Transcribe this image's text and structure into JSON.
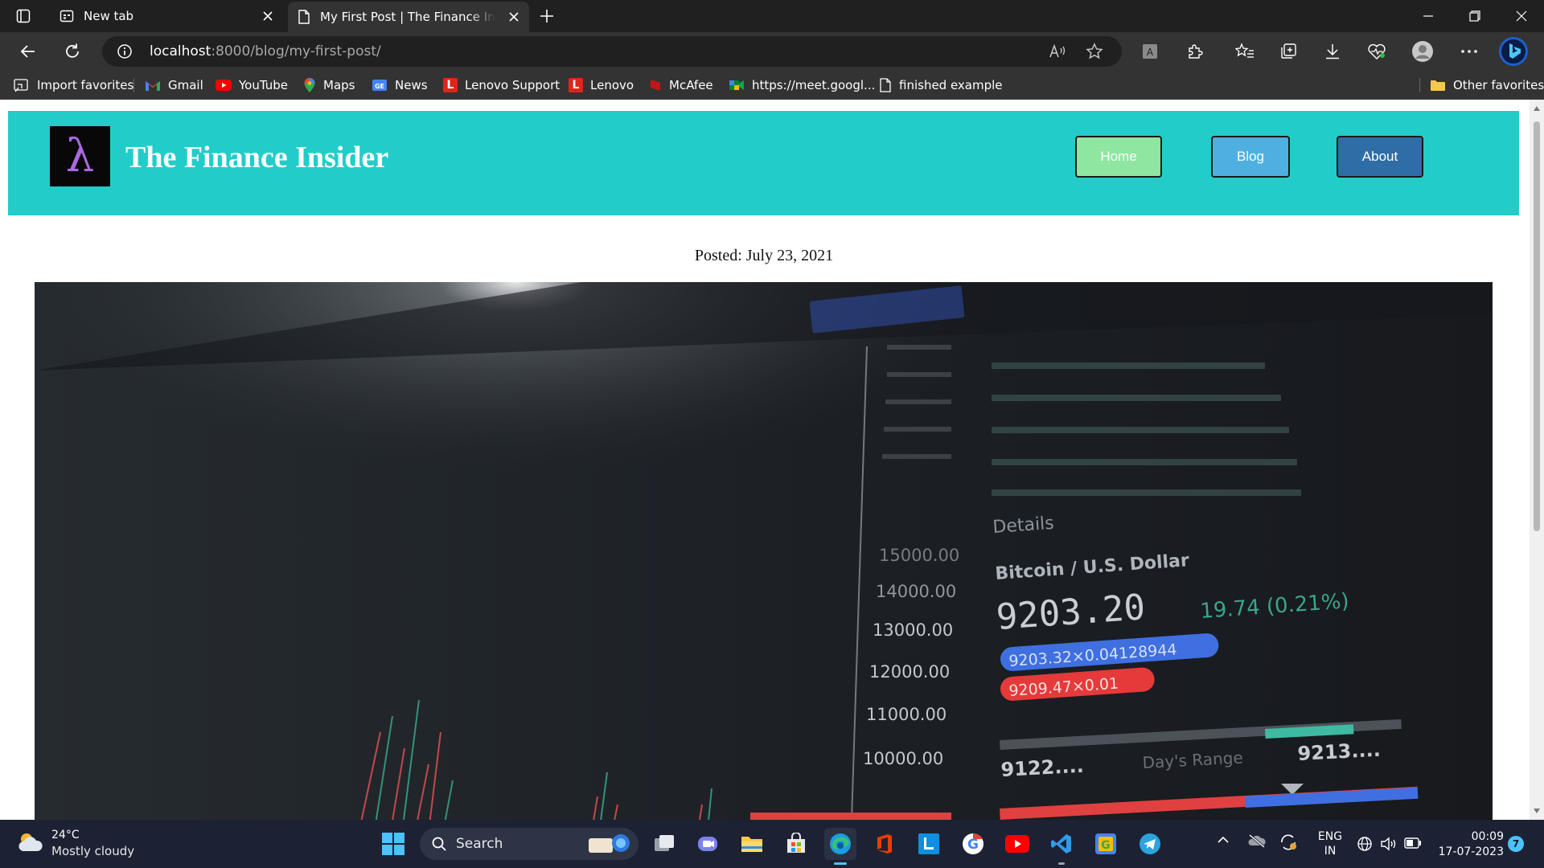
{
  "tabs": [
    {
      "label": "New tab",
      "icon": "new-tab-icon"
    },
    {
      "label": "My First Post | The Finance Insider",
      "icon": "page-icon",
      "active": true
    }
  ],
  "address_bar": {
    "host": "localhost",
    "path": ":8000/blog/my-first-post/"
  },
  "favorites": [
    {
      "label": "Import favorites",
      "icon": "import-icon"
    },
    {
      "label": "Gmail",
      "icon": "gmail-icon"
    },
    {
      "label": "YouTube",
      "icon": "youtube-icon"
    },
    {
      "label": "Maps",
      "icon": "maps-icon"
    },
    {
      "label": "News",
      "icon": "news-icon"
    },
    {
      "label": "Lenovo Support",
      "icon": "lenovo-icon"
    },
    {
      "label": "Lenovo",
      "icon": "lenovo-icon"
    },
    {
      "label": "McAfee",
      "icon": "mcafee-icon"
    },
    {
      "label": "https://meet.googl...",
      "icon": "meet-icon"
    },
    {
      "label": "finished example",
      "icon": "page-icon"
    }
  ],
  "other_favorites": "Other favorites",
  "site": {
    "logo_glyph": "λ",
    "title": "The Finance Insider",
    "nav": {
      "home": "Home",
      "blog": "Blog",
      "about": "About"
    },
    "posted": "Posted: July 23, 2021"
  },
  "hero_image": {
    "price_axis": [
      "15000.00",
      "14000.00",
      "13000.00",
      "12000.00",
      "11000.00",
      "10000.00"
    ],
    "details": "Details",
    "pair": "Bitcoin / U.S. Dollar",
    "price": "9203.20",
    "change": "19.74 (0.21%)",
    "bid": "9203.32×0.04128944",
    "ask": "9209.47×0.01",
    "range_low": "9122....",
    "range_label": "Day's Range",
    "range_high": "9213...."
  },
  "taskbar": {
    "temperature": "24°C",
    "weather": "Mostly cloudy",
    "search": "Search",
    "lang": "ENG",
    "region": "IN",
    "time": "00:09",
    "date": "17-07-2023",
    "notifications": "7"
  },
  "colors": {
    "header_bg": "#22cdc9",
    "home_btn": "#8ee6a0",
    "blog_btn": "#4fb0e0",
    "about_btn": "#2f6da6"
  }
}
